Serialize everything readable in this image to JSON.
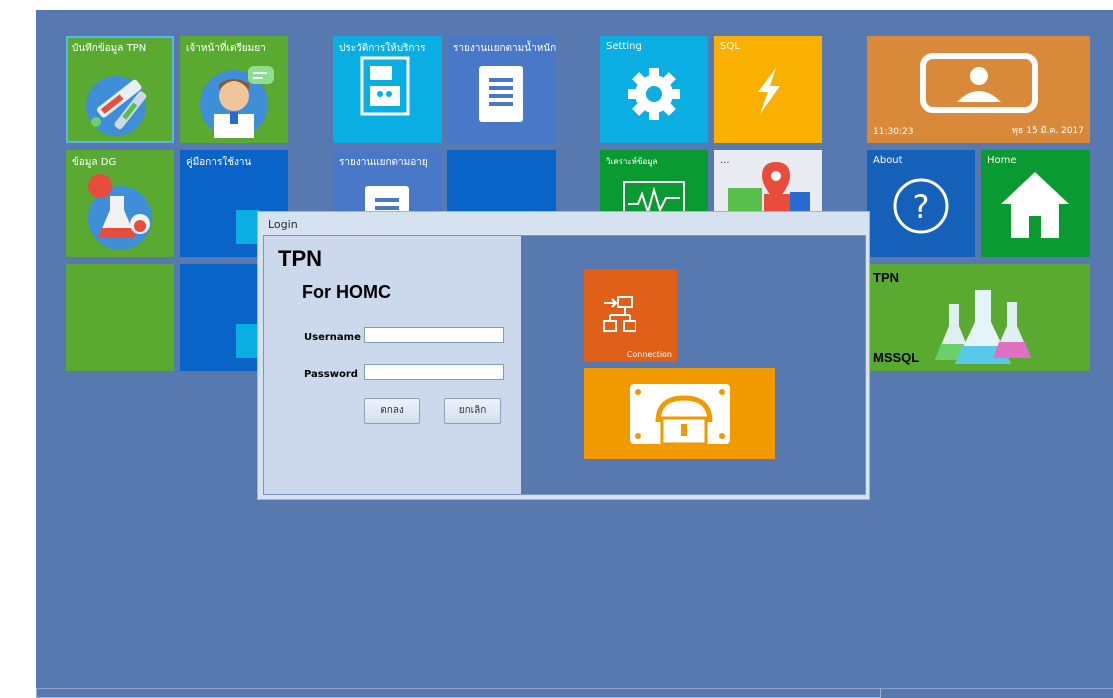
{
  "tiles": {
    "tpn_record": "บันทึกข้อมูล TPN",
    "pharmacist": "เจ้าหน้าที่เตรียมยา",
    "service_history": "ประวัติการให้บริการ",
    "report_weight": "รายงานแยกตามน้ำหนัก",
    "setting": "Setting",
    "sql": "SQL",
    "clock_time": "11:30:23",
    "clock_date": "พุธ 15 มี.ค. 2017",
    "dg_data": "ข้อมูล DG",
    "manual": "คู่มือการใช้งาน",
    "report_age": "รายงานแยกตามอายุ",
    "analyze": "วิเคราะห์ข้อมูล",
    "more": "...",
    "about": "About",
    "home": "Home",
    "tpn_mssql_top": "TPN",
    "tpn_mssql_bottom": "MSSQL"
  },
  "login": {
    "window_title": "Login",
    "heading": "TPN",
    "subheading": "For HOMC",
    "username_label": "Username",
    "password_label": "Password",
    "username_value": "",
    "password_value": "",
    "ok_button": "ตกลง",
    "cancel_button": "ยกเลิก",
    "connection_caption": "Connection"
  },
  "colors": {
    "desktop": "#5878b0",
    "green": "#5aaa32",
    "blue": "#0a64c8",
    "orange": "#e0601a",
    "amber": "#f09a00"
  }
}
